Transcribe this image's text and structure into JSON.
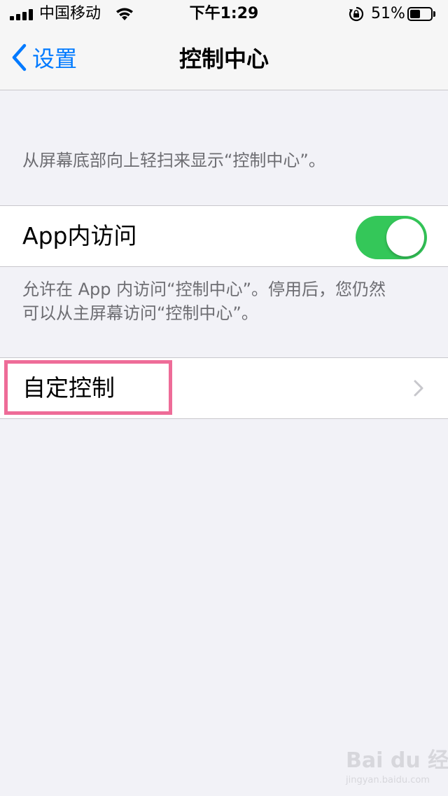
{
  "status_bar": {
    "carrier": "中国移动",
    "time": "下午1:29",
    "battery_percent": "51%",
    "battery_level": 0.51,
    "icons": [
      "signal-icon",
      "wifi-icon",
      "rotation-lock-icon",
      "battery-icon"
    ]
  },
  "nav": {
    "back_label": "设置",
    "title": "控制中心"
  },
  "sections": {
    "intro_text": "从屏幕底部向上轻扫来显示“控制中心”。",
    "in_app_access": {
      "label": "App内访问",
      "toggle_on": true,
      "toggle_color": "#34c759"
    },
    "in_app_note_line1": "允许在 App 内访问“控制中心”。停用后，您仍然",
    "in_app_note_line2": "可以从主屏幕访问“控制中心”。",
    "customize": {
      "label": "自定控制"
    }
  },
  "colors": {
    "accent": "#007aff",
    "highlight": "#ee6c98",
    "background": "#f2f2f7"
  },
  "watermark": {
    "main": "Bai du 经验",
    "sub": "jingyan.baidu.com"
  }
}
